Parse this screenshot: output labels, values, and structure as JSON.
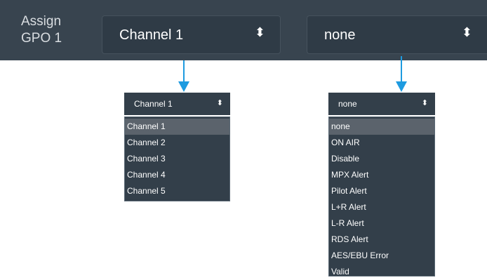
{
  "top_bar": {
    "label_line1": "Assign",
    "label_line2": "GPO 1",
    "channel_select": {
      "value": "Channel 1",
      "arrow_icon": "sort-arrows-icon"
    },
    "gpo_select": {
      "value": "none",
      "arrow_icon": "sort-arrows-icon"
    }
  },
  "channel_dropdown": {
    "value": "Channel 1",
    "options": [
      "Channel 1",
      "Channel 2",
      "Channel 3",
      "Channel 4",
      "Channel 5"
    ],
    "highlighted": "Channel 1"
  },
  "gpo_dropdown": {
    "value": "none",
    "options": [
      "none",
      "ON AIR",
      "Disable",
      "MPX Alert",
      "Pilot Alert",
      "L+R Alert",
      "L-R Alert",
      "RDS Alert",
      "AES/EBU Error",
      "Valid"
    ],
    "highlighted": "none"
  },
  "colors": {
    "bar_bg": "#38444f",
    "select_bg": "#2f3b46",
    "connector": "#1e9be0",
    "highlight": "#5b636c"
  }
}
